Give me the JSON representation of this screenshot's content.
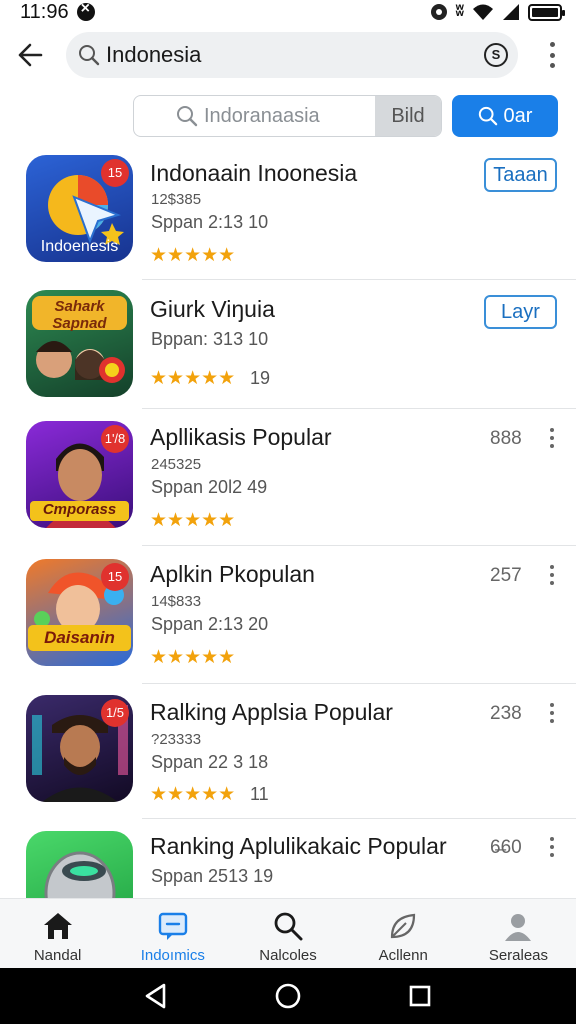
{
  "status_bar": {
    "time": "11:96"
  },
  "search": {
    "query": "Indonesia"
  },
  "secondary_search": {
    "placeholder": "Indoranaasia",
    "button_label": "Bild"
  },
  "primary_action": {
    "label": "0ar"
  },
  "apps": [
    {
      "title": "Indonaain Inoonesia",
      "line1": "12$385",
      "line2": "Sppan 2:13  10",
      "stars": "★★★★★",
      "rating_count": "",
      "action_label": "Taaan",
      "side_number": "",
      "badge": "15",
      "icon_caption": "Indoenesis",
      "icon_colors": [
        "#1c4bb8",
        "#f5b81c"
      ]
    },
    {
      "title": "Giurk Viŋuia",
      "line1": "",
      "line2": "Bppan: 313  10",
      "stars": "★★★★★",
      "rating_count": "19",
      "action_label": "Layr",
      "side_number": "",
      "badge": "",
      "icon_caption": "Sahark Sapnad",
      "icon_colors": [
        "#1d5e3a",
        "#e9a522"
      ]
    },
    {
      "title": "Apllikasis Popular",
      "line1": "245325",
      "line2": "Sppan 20l2  49",
      "stars": "★★★★★",
      "rating_count": "",
      "action_label": "",
      "side_number": "888",
      "badge": "1'/8",
      "icon_caption": "Cmporass",
      "icon_colors": [
        "#6a1fa8",
        "#f3c21b"
      ]
    },
    {
      "title": "Aplkin Pkopulan",
      "line1": "14$833",
      "line2": "Sppan 2:13  20",
      "stars": "★★★★★",
      "rating_count": "",
      "action_label": "",
      "side_number": "257",
      "badge": "15",
      "icon_caption": "Daisanin",
      "icon_colors": [
        "#e8532a",
        "#2a8de0"
      ]
    },
    {
      "title": "Ralking Applsia Popular",
      "line1": "?23333",
      "line2": "Sppan 22 3  18",
      "stars": "★★★★★",
      "rating_count": "11",
      "action_label": "",
      "side_number": "238",
      "badge": "1/5",
      "icon_caption": "",
      "icon_colors": [
        "#2a1a4a",
        "#f05a2a"
      ]
    },
    {
      "title": "Ranking Aplulikakaic Popular",
      "line1": "",
      "line2": "Sppan 2513  19",
      "stars": "",
      "rating_count": "",
      "action_label": "",
      "side_number": "6̶60",
      "badge": "",
      "icon_caption": "",
      "icon_colors": [
        "#3ccf5a",
        "#8a8f94"
      ]
    }
  ],
  "bottom_nav": [
    {
      "label": "Nandal",
      "icon": "home-icon",
      "active": false
    },
    {
      "label": "Indoımics",
      "icon": "message-icon",
      "active": true
    },
    {
      "label": "Nalcoles",
      "icon": "search-icon",
      "active": false
    },
    {
      "label": "Acllenn",
      "icon": "leaf-icon",
      "active": false
    },
    {
      "label": "Seraleas",
      "icon": "person-icon",
      "active": false
    }
  ],
  "colors": {
    "accent": "#1a7fe8",
    "star": "#f2a20c",
    "badge": "#e0322e"
  }
}
